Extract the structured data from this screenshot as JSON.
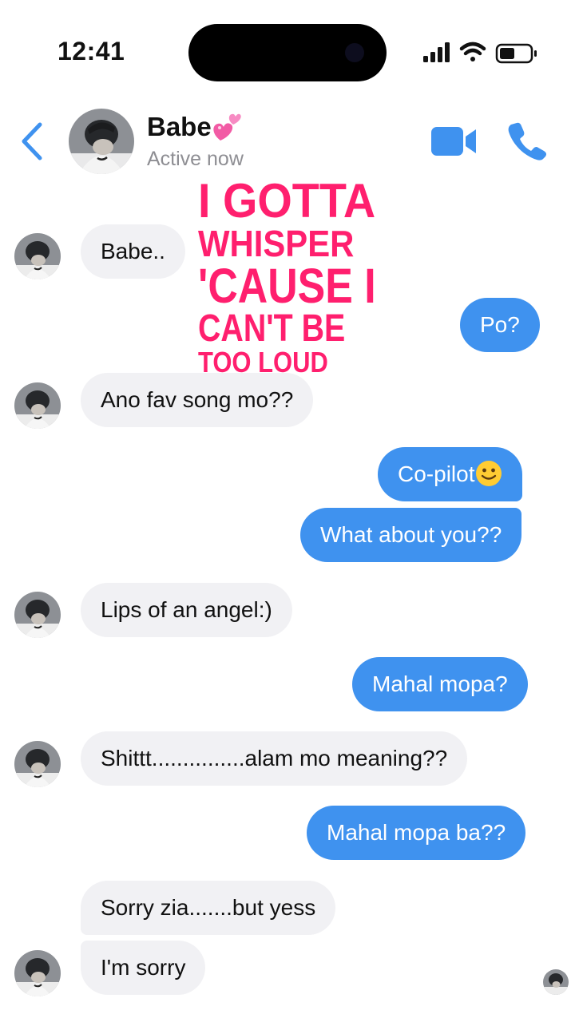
{
  "status_bar": {
    "time": "12:41"
  },
  "header": {
    "back_icon": "chevron-left-icon",
    "contact_name": "Babe",
    "name_emoji": "two-hearts-icon",
    "status": "Active now",
    "video_icon": "video-camera-icon",
    "phone_icon": "phone-icon",
    "accent_color": "#3f92ef"
  },
  "overlay_lyrics": {
    "line1": "I GOTTA",
    "line2": "WHISPER",
    "line3": "'CAUSE I",
    "line4": "CAN'T BE",
    "line5": "TOO LOUD",
    "color": "#ff1f6e"
  },
  "messages": [
    {
      "from": "them",
      "text": "Babe.."
    },
    {
      "from": "me",
      "text": "Po?"
    },
    {
      "from": "them",
      "text": "Ano fav song mo??"
    },
    {
      "from": "me",
      "text": "Co-pilot",
      "emoji": "slightly-smiling-face-icon"
    },
    {
      "from": "me",
      "text": "What about you??"
    },
    {
      "from": "them",
      "text": "Lips of an angel:)"
    },
    {
      "from": "me",
      "text": "Mahal mopa?"
    },
    {
      "from": "them",
      "text": "Shittt...............alam mo meaning??"
    },
    {
      "from": "me",
      "text": "Mahal mopa ba??"
    },
    {
      "from": "them",
      "text": "Sorry zia.......but yess"
    },
    {
      "from": "them",
      "text": "I'm sorry"
    }
  ],
  "colors": {
    "incoming_bubble": "#f1f1f4",
    "outgoing_bubble": "#3f92ef"
  }
}
